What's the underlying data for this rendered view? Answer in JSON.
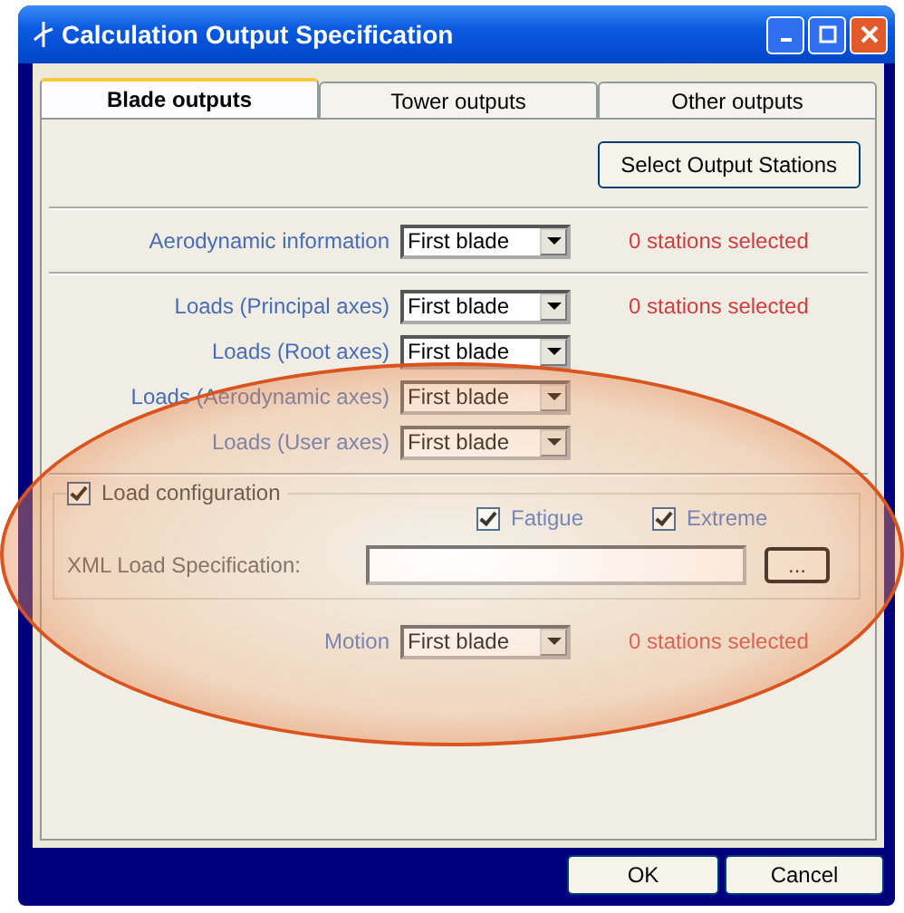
{
  "window": {
    "title": "Calculation Output Specification"
  },
  "tabs": [
    {
      "label": "Blade outputs",
      "selected": true
    },
    {
      "label": "Tower outputs",
      "selected": false
    },
    {
      "label": "Other outputs",
      "selected": false
    }
  ],
  "select_button": "Select Output Stations",
  "sections": [
    {
      "rows": [
        {
          "label": "Aerodynamic information",
          "combo": "First blade",
          "status": "0 stations selected"
        }
      ]
    },
    {
      "rows": [
        {
          "label": "Loads (Principal axes)",
          "combo": "First blade",
          "status": "0 stations selected"
        },
        {
          "label": "Loads (Root axes)",
          "combo": "First blade"
        },
        {
          "label": "Loads (Aerodynamic axes)",
          "combo": "First blade"
        },
        {
          "label": "Loads (User axes)",
          "combo": "First blade"
        }
      ]
    }
  ],
  "load_configuration": {
    "label": "Load configuration",
    "checked": true,
    "options": [
      {
        "label": "Fatigue",
        "checked": true
      },
      {
        "label": "Extreme",
        "checked": true
      }
    ],
    "xml_label": "XML Load Specification:",
    "browse": "..."
  },
  "motion": {
    "label": "Motion",
    "combo": "First blade",
    "status": "0 stations selected"
  },
  "buttons": [
    "OK",
    "Cancel"
  ]
}
